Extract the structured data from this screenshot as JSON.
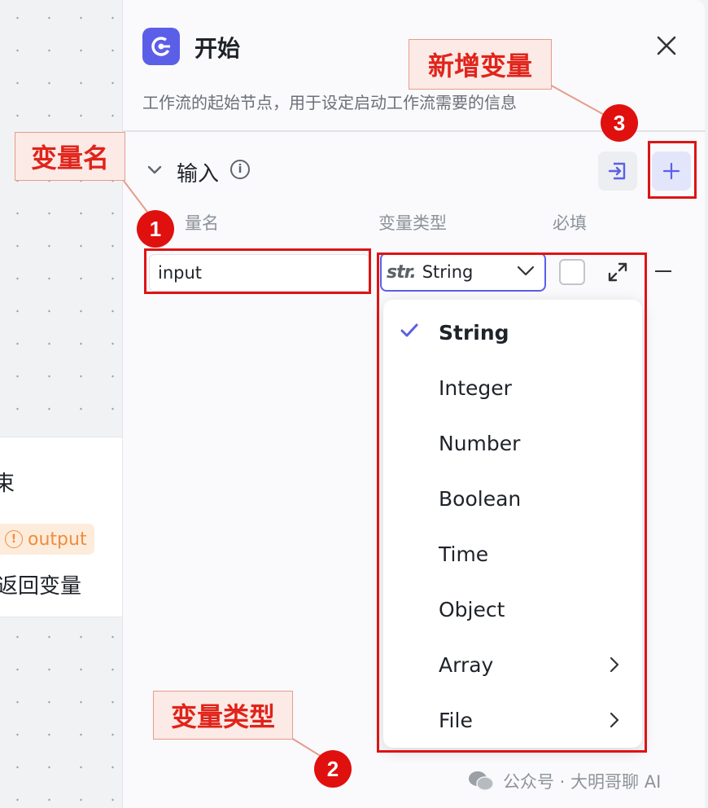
{
  "canvas_node": {
    "title_fragment": "束",
    "badge_label": "output",
    "description_fragment": "返回变量"
  },
  "panel": {
    "title": "开始",
    "description": "工作流的起始节点，用于设定启动工作流需要的信息",
    "section_title": "输入",
    "columns": {
      "name": "量名",
      "type": "变量类型",
      "required": "必填"
    },
    "row": {
      "name_value": "input",
      "type_prefix": "str.",
      "type_value": "String",
      "required": false
    }
  },
  "dropdown": {
    "selected": "String",
    "options": [
      {
        "label": "String",
        "has_submenu": false
      },
      {
        "label": "Integer",
        "has_submenu": false
      },
      {
        "label": "Number",
        "has_submenu": false
      },
      {
        "label": "Boolean",
        "has_submenu": false
      },
      {
        "label": "Time",
        "has_submenu": false
      },
      {
        "label": "Object",
        "has_submenu": false
      },
      {
        "label": "Array",
        "has_submenu": true
      },
      {
        "label": "File",
        "has_submenu": true
      }
    ]
  },
  "annotations": {
    "var_name_label": "变量名",
    "var_name_number": "1",
    "var_type_label": "变量类型",
    "var_type_number": "2",
    "add_var_label": "新增变量",
    "add_var_number": "3"
  },
  "watermark": {
    "text": "公众号 · 大明哥聊 AI"
  },
  "colors": {
    "accent": "#5b5fe8",
    "annotation_red": "#e0100f",
    "badge_orange": "#f08c3e"
  },
  "icons": [
    "start-node-icon",
    "close-icon",
    "chevron-down-icon",
    "info-icon",
    "import-icon",
    "plus-icon",
    "expand-icon",
    "remove-icon",
    "check-icon",
    "chevron-right-icon",
    "warning-icon",
    "wechat-icon"
  ]
}
